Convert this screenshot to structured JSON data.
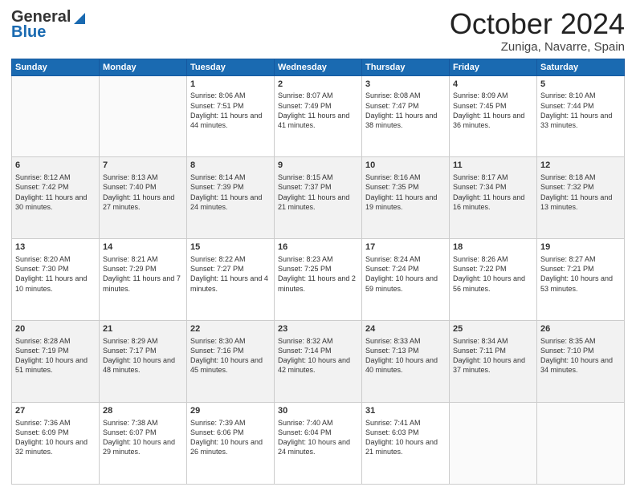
{
  "header": {
    "logo_general": "General",
    "logo_blue": "Blue",
    "month_title": "October 2024",
    "location": "Zuniga, Navarre, Spain"
  },
  "days_of_week": [
    "Sunday",
    "Monday",
    "Tuesday",
    "Wednesday",
    "Thursday",
    "Friday",
    "Saturday"
  ],
  "weeks": [
    [
      {
        "day": "",
        "info": []
      },
      {
        "day": "",
        "info": []
      },
      {
        "day": "1",
        "info": [
          "Sunrise: 8:06 AM",
          "Sunset: 7:51 PM",
          "Daylight: 11 hours and 44 minutes."
        ]
      },
      {
        "day": "2",
        "info": [
          "Sunrise: 8:07 AM",
          "Sunset: 7:49 PM",
          "Daylight: 11 hours and 41 minutes."
        ]
      },
      {
        "day": "3",
        "info": [
          "Sunrise: 8:08 AM",
          "Sunset: 7:47 PM",
          "Daylight: 11 hours and 38 minutes."
        ]
      },
      {
        "day": "4",
        "info": [
          "Sunrise: 8:09 AM",
          "Sunset: 7:45 PM",
          "Daylight: 11 hours and 36 minutes."
        ]
      },
      {
        "day": "5",
        "info": [
          "Sunrise: 8:10 AM",
          "Sunset: 7:44 PM",
          "Daylight: 11 hours and 33 minutes."
        ]
      }
    ],
    [
      {
        "day": "6",
        "info": [
          "Sunrise: 8:12 AM",
          "Sunset: 7:42 PM",
          "Daylight: 11 hours and 30 minutes."
        ]
      },
      {
        "day": "7",
        "info": [
          "Sunrise: 8:13 AM",
          "Sunset: 7:40 PM",
          "Daylight: 11 hours and 27 minutes."
        ]
      },
      {
        "day": "8",
        "info": [
          "Sunrise: 8:14 AM",
          "Sunset: 7:39 PM",
          "Daylight: 11 hours and 24 minutes."
        ]
      },
      {
        "day": "9",
        "info": [
          "Sunrise: 8:15 AM",
          "Sunset: 7:37 PM",
          "Daylight: 11 hours and 21 minutes."
        ]
      },
      {
        "day": "10",
        "info": [
          "Sunrise: 8:16 AM",
          "Sunset: 7:35 PM",
          "Daylight: 11 hours and 19 minutes."
        ]
      },
      {
        "day": "11",
        "info": [
          "Sunrise: 8:17 AM",
          "Sunset: 7:34 PM",
          "Daylight: 11 hours and 16 minutes."
        ]
      },
      {
        "day": "12",
        "info": [
          "Sunrise: 8:18 AM",
          "Sunset: 7:32 PM",
          "Daylight: 11 hours and 13 minutes."
        ]
      }
    ],
    [
      {
        "day": "13",
        "info": [
          "Sunrise: 8:20 AM",
          "Sunset: 7:30 PM",
          "Daylight: 11 hours and 10 minutes."
        ]
      },
      {
        "day": "14",
        "info": [
          "Sunrise: 8:21 AM",
          "Sunset: 7:29 PM",
          "Daylight: 11 hours and 7 minutes."
        ]
      },
      {
        "day": "15",
        "info": [
          "Sunrise: 8:22 AM",
          "Sunset: 7:27 PM",
          "Daylight: 11 hours and 4 minutes."
        ]
      },
      {
        "day": "16",
        "info": [
          "Sunrise: 8:23 AM",
          "Sunset: 7:25 PM",
          "Daylight: 11 hours and 2 minutes."
        ]
      },
      {
        "day": "17",
        "info": [
          "Sunrise: 8:24 AM",
          "Sunset: 7:24 PM",
          "Daylight: 10 hours and 59 minutes."
        ]
      },
      {
        "day": "18",
        "info": [
          "Sunrise: 8:26 AM",
          "Sunset: 7:22 PM",
          "Daylight: 10 hours and 56 minutes."
        ]
      },
      {
        "day": "19",
        "info": [
          "Sunrise: 8:27 AM",
          "Sunset: 7:21 PM",
          "Daylight: 10 hours and 53 minutes."
        ]
      }
    ],
    [
      {
        "day": "20",
        "info": [
          "Sunrise: 8:28 AM",
          "Sunset: 7:19 PM",
          "Daylight: 10 hours and 51 minutes."
        ]
      },
      {
        "day": "21",
        "info": [
          "Sunrise: 8:29 AM",
          "Sunset: 7:17 PM",
          "Daylight: 10 hours and 48 minutes."
        ]
      },
      {
        "day": "22",
        "info": [
          "Sunrise: 8:30 AM",
          "Sunset: 7:16 PM",
          "Daylight: 10 hours and 45 minutes."
        ]
      },
      {
        "day": "23",
        "info": [
          "Sunrise: 8:32 AM",
          "Sunset: 7:14 PM",
          "Daylight: 10 hours and 42 minutes."
        ]
      },
      {
        "day": "24",
        "info": [
          "Sunrise: 8:33 AM",
          "Sunset: 7:13 PM",
          "Daylight: 10 hours and 40 minutes."
        ]
      },
      {
        "day": "25",
        "info": [
          "Sunrise: 8:34 AM",
          "Sunset: 7:11 PM",
          "Daylight: 10 hours and 37 minutes."
        ]
      },
      {
        "day": "26",
        "info": [
          "Sunrise: 8:35 AM",
          "Sunset: 7:10 PM",
          "Daylight: 10 hours and 34 minutes."
        ]
      }
    ],
    [
      {
        "day": "27",
        "info": [
          "Sunrise: 7:36 AM",
          "Sunset: 6:09 PM",
          "Daylight: 10 hours and 32 minutes."
        ]
      },
      {
        "day": "28",
        "info": [
          "Sunrise: 7:38 AM",
          "Sunset: 6:07 PM",
          "Daylight: 10 hours and 29 minutes."
        ]
      },
      {
        "day": "29",
        "info": [
          "Sunrise: 7:39 AM",
          "Sunset: 6:06 PM",
          "Daylight: 10 hours and 26 minutes."
        ]
      },
      {
        "day": "30",
        "info": [
          "Sunrise: 7:40 AM",
          "Sunset: 6:04 PM",
          "Daylight: 10 hours and 24 minutes."
        ]
      },
      {
        "day": "31",
        "info": [
          "Sunrise: 7:41 AM",
          "Sunset: 6:03 PM",
          "Daylight: 10 hours and 21 minutes."
        ]
      },
      {
        "day": "",
        "info": []
      },
      {
        "day": "",
        "info": []
      }
    ]
  ]
}
